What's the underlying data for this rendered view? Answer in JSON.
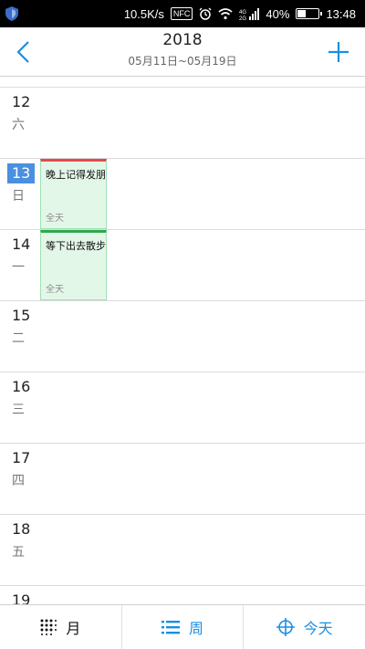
{
  "status_bar": {
    "speed": "10.5K/s",
    "nfc": "NFC",
    "battery_percent": "40%",
    "battery_level": 0.4,
    "time": "13:48"
  },
  "header": {
    "year": "2018",
    "range": "05月11日~05月19日"
  },
  "days": [
    {
      "num": "12",
      "week": "六"
    },
    {
      "num": "13",
      "week": "日"
    },
    {
      "num": "14",
      "week": "一"
    },
    {
      "num": "15",
      "week": "二"
    },
    {
      "num": "16",
      "week": "三"
    },
    {
      "num": "17",
      "week": "四"
    },
    {
      "num": "18",
      "week": "五"
    },
    {
      "num": "19",
      "week": ""
    }
  ],
  "events": [
    {
      "title": "晚上记得发朋",
      "allday": "全天",
      "color": "#e04b4b"
    },
    {
      "title": "等下出去散步",
      "allday": "全天",
      "color": "#2fa84f"
    }
  ],
  "bottom_tabs": {
    "month": "月",
    "week": "周",
    "today": "今天"
  },
  "colors": {
    "accent": "#1a8fe3",
    "today_highlight": "#4a8fe0"
  }
}
